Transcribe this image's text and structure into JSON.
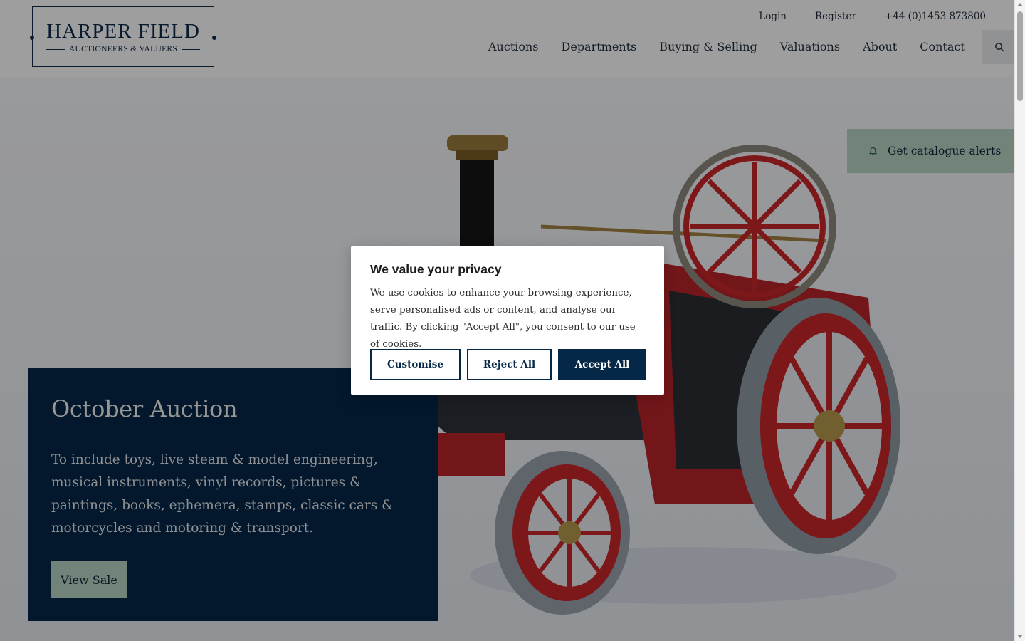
{
  "header": {
    "logo": {
      "name": "HARPER FIELD",
      "sub": "AUCTIONEERS & VALUERS"
    },
    "utility": {
      "login": "Login",
      "register": "Register",
      "phone": "+44 (0)1453 873800"
    },
    "nav": [
      "Auctions",
      "Departments",
      "Buying & Selling",
      "Valuations",
      "About",
      "Contact"
    ]
  },
  "alerts": {
    "label": "Get catalogue alerts"
  },
  "promo": {
    "title": "October Auction",
    "description": "To include toys, live steam & model engineering, musical instruments, vinyl records, pictures & paintings, books, ephemera, stamps, classic cars & motorcycles and motoring & transport.",
    "button": "View Sale"
  },
  "cookie": {
    "title": "We value your privacy",
    "body": "We use cookies to enhance your browsing experience, serve personalised ads or content, and analyse our traffic. By clicking \"Accept All\", you consent to our use of cookies.",
    "customise": "Customise",
    "reject": "Reject All",
    "accept": "Accept All"
  },
  "colors": {
    "navy": "#062848",
    "mint": "#b9d4c6",
    "engine_red": "#c8262b"
  }
}
